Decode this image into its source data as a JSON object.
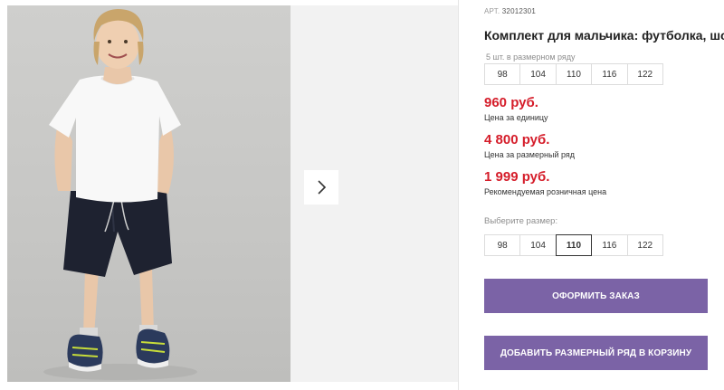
{
  "gallery": {
    "next_arrow_icon": "chevron-right-icon"
  },
  "product": {
    "article_prefix": "АРТ.",
    "article_number": "32012301",
    "title": "Комплект для мальчика: футболка, шорты",
    "size_hint": "5 шт. в размерном ряду",
    "sizes": [
      "98",
      "104",
      "110",
      "116",
      "122"
    ],
    "prices": [
      {
        "value": "960 руб.",
        "label": "Цена за единицу"
      },
      {
        "value": "4 800 руб.",
        "label": "Цена за размерный ряд"
      },
      {
        "value": "1 999 руб.",
        "label": "Рекомендуемая розничная цена"
      }
    ],
    "choose_size_label": "Выберите размер:",
    "selected_size": "110",
    "order_button": "Оформить заказ",
    "cart_button": "Добавить размерный ряд в корзину"
  },
  "colors": {
    "price": "#d51d2a",
    "button": "#7b63a6"
  }
}
